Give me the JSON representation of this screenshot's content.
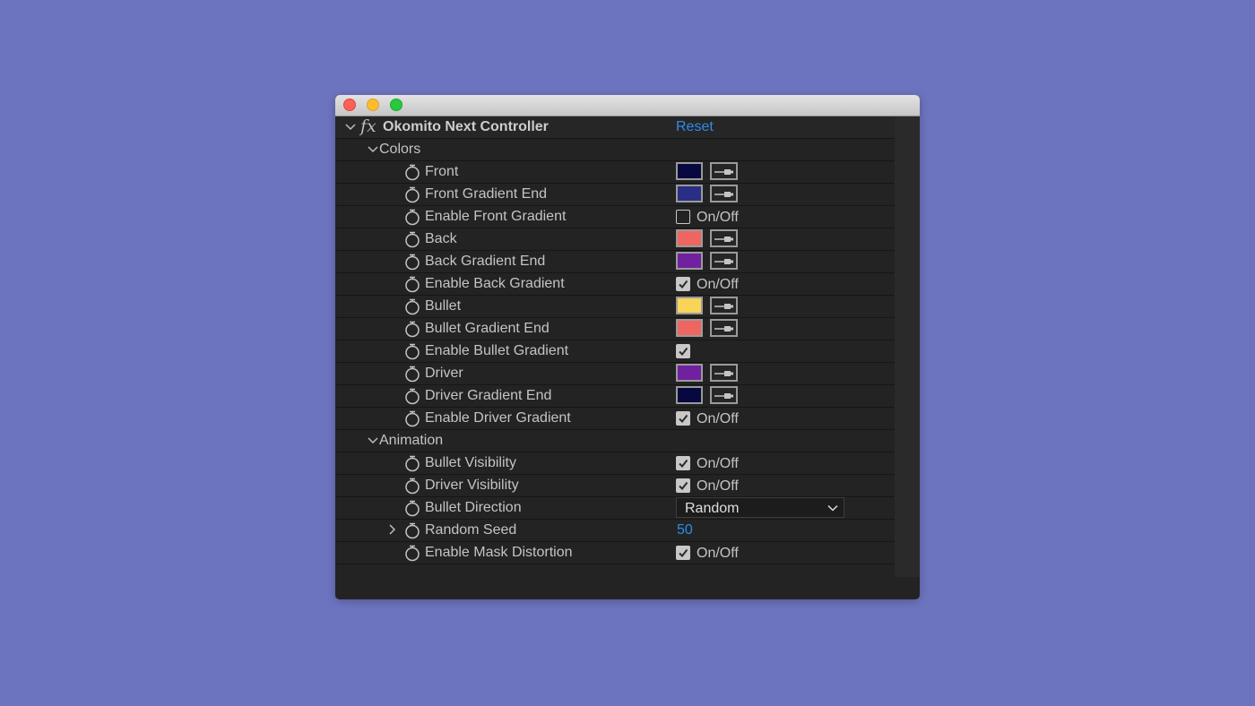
{
  "effect": {
    "name": "Okomito Next Controller",
    "fx_label": "fx",
    "reset_label": "Reset"
  },
  "groups": {
    "colors": "Colors",
    "animation": "Animation"
  },
  "on_off_label": "On/Off",
  "params": {
    "front": {
      "label": "Front",
      "color": "#07083f"
    },
    "front_gradient_end": {
      "label": "Front Gradient End",
      "color": "#2a2e84"
    },
    "enable_front_gradient": {
      "label": "Enable Front Gradient",
      "checked": false
    },
    "back": {
      "label": "Back",
      "color": "#ef6661"
    },
    "back_gradient_end": {
      "label": "Back Gradient End",
      "color": "#6f21a0"
    },
    "enable_back_gradient": {
      "label": "Enable Back Gradient",
      "checked": true
    },
    "bullet": {
      "label": "Bullet",
      "color": "#f9d458"
    },
    "bullet_gradient_end": {
      "label": "Bullet Gradient End",
      "color": "#ef6661"
    },
    "enable_bullet_gradient": {
      "label": "Enable Bullet Gradient",
      "checked": true
    },
    "driver": {
      "label": "Driver",
      "color": "#6f21a0"
    },
    "driver_gradient_end": {
      "label": "Driver Gradient End",
      "color": "#07083f"
    },
    "enable_driver_gradient": {
      "label": "Enable Driver Gradient",
      "checked": true
    },
    "bullet_visibility": {
      "label": "Bullet Visibility",
      "checked": true
    },
    "driver_visibility": {
      "label": "Driver Visibility",
      "checked": true
    },
    "bullet_direction": {
      "label": "Bullet Direction",
      "value": "Random"
    },
    "random_seed": {
      "label": "Random Seed",
      "value": "50"
    },
    "enable_mask_distortion": {
      "label": "Enable Mask Distortion",
      "checked": true
    }
  },
  "colors": {
    "background": "#6d74bf",
    "panel": "#232323",
    "accent_link": "#2d8ceb",
    "text": "#c4c4c4"
  },
  "icons": {
    "stopwatch": "stopwatch-icon",
    "eyedropper": "eyedropper-icon",
    "expand": "chevron-down-icon",
    "collapse": "chevron-right-icon"
  }
}
